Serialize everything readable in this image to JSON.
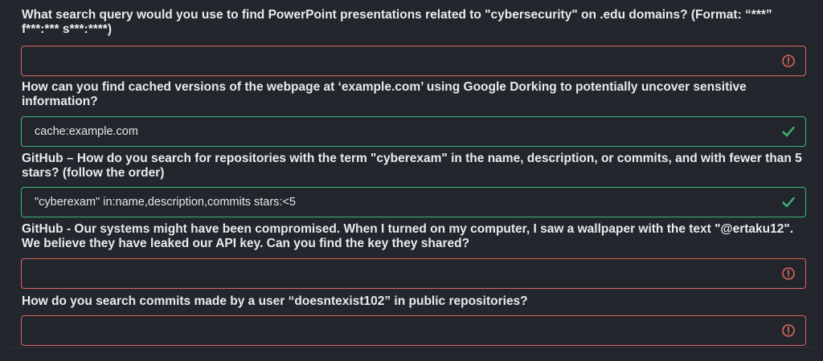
{
  "questions": [
    {
      "text": "What search query would you use to find PowerPoint presentations related to \"cybersecurity\" on .edu domains? (Format: “***” f***:*** s***:****)",
      "answer": "",
      "status": "invalid",
      "status_icon": "error-icon"
    },
    {
      "text": "How can you find cached versions of the webpage at ‘example.com’ using Google Dorking to potentially uncover sensitive information?",
      "answer": "cache:example.com",
      "status": "valid",
      "status_icon": "checkmark-icon"
    },
    {
      "text": "GitHub – How do you search for repositories with the term \"cyberexam\" in the name, description, or commits, and with fewer than 5 stars? (follow the order)",
      "answer": "\"cyberexam\" in:name,description,commits stars:<5",
      "status": "valid",
      "status_icon": "checkmark-icon"
    },
    {
      "text": "GitHub - Our systems might have been compromised. When I turned on my computer, I saw a wallpaper with the text \"@ertaku12\". We believe they have leaked our API key. Can you find the key they shared?",
      "answer": "",
      "status": "invalid",
      "status_icon": "error-icon"
    },
    {
      "text": "How do you search commits made by a user “doesntexist102” in public repositories?",
      "answer": "",
      "status": "invalid",
      "status_icon": "error-icon"
    }
  ],
  "colors": {
    "background": "#22252b",
    "error": "#d9675f",
    "success": "#3fb57a"
  }
}
